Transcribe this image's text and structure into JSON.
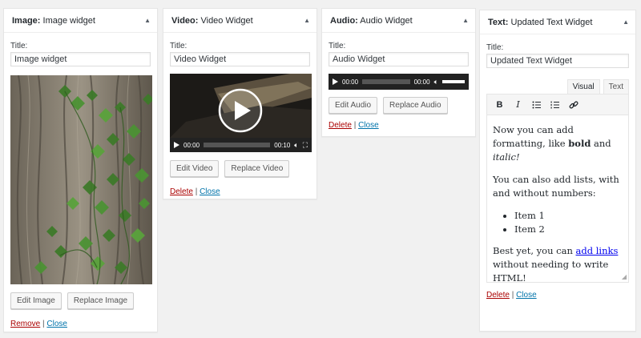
{
  "widgets": {
    "image": {
      "type": "Image:",
      "name": "Image widget",
      "title_label": "Title:",
      "title_value": "Image widget",
      "edit_label": "Edit Image",
      "replace_label": "Replace Image",
      "remove_label": "Remove",
      "close_label": "Close",
      "separator": "|"
    },
    "video": {
      "type": "Video:",
      "name": "Video Widget",
      "title_label": "Title:",
      "title_value": "Video Widget",
      "time_current": "00:00",
      "time_total": "00:10",
      "edit_label": "Edit Video",
      "replace_label": "Replace Video",
      "delete_label": "Delete",
      "close_label": "Close",
      "separator": "|"
    },
    "audio": {
      "type": "Audio:",
      "name": "Audio Widget",
      "title_label": "Title:",
      "title_value": "Audio Widget",
      "time_current": "00:00",
      "time_total": "00:00",
      "edit_label": "Edit Audio",
      "replace_label": "Replace Audio",
      "delete_label": "Delete",
      "close_label": "Close",
      "separator": "|"
    },
    "text": {
      "type": "Text:",
      "name": "Updated Text Widget",
      "title_label": "Title:",
      "title_value": "Updated Text Widget",
      "tab_visual": "Visual",
      "tab_text": "Text",
      "content": {
        "p1_a": "Now you can add formatting, like ",
        "p1_bold": "bold",
        "p1_and": " and ",
        "p1_italic": "italic!",
        "p2": "You can also add lists, with and without numbers:",
        "item1": "Item 1",
        "item2": "Item 2",
        "p3_a": "Best yet, you can ",
        "p3_link": "add links",
        "p3_b": " without needing to write HTML!"
      },
      "delete_label": "Delete",
      "close_label": "Close",
      "separator": "|"
    }
  },
  "colors": {
    "page_bg": "#f1f1f1",
    "delete": "#aa0000",
    "link": "#0073aa",
    "ivy_green": "#3e7a2a",
    "bark": "#8a8273"
  },
  "icons": [
    "toggle-arrow-icon",
    "play-icon",
    "volume-icon",
    "fullscreen-icon",
    "bold-icon",
    "italic-icon",
    "bullet-list-icon",
    "numbered-list-icon",
    "link-icon",
    "resize-handle-icon"
  ]
}
